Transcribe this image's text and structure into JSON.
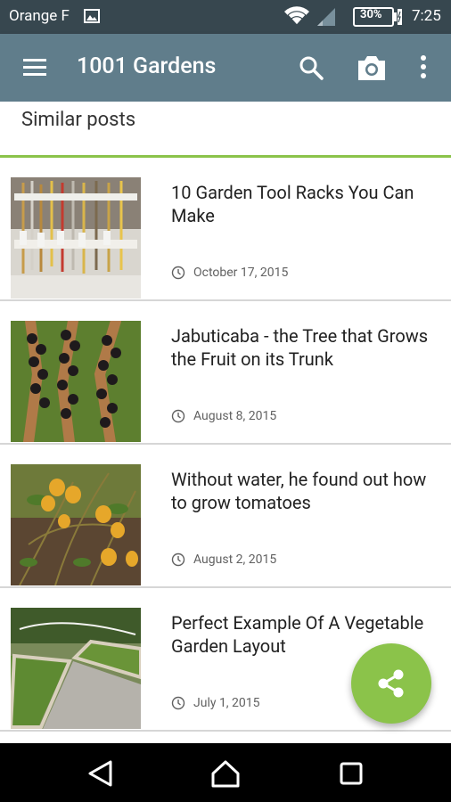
{
  "status_bar": {
    "carrier": "Orange F",
    "battery": "30%",
    "time": "7:25",
    "icons": [
      "image-notification-icon",
      "wifi-icon",
      "cell-signal-icon",
      "battery-charging-icon"
    ]
  },
  "app_bar": {
    "title": "1001 Gardens",
    "icons": [
      "menu-icon",
      "search-icon",
      "camera-icon",
      "more-vert-icon"
    ],
    "color": "#607d8b"
  },
  "section": {
    "label": "Similar posts",
    "accent_color": "#8bc34a"
  },
  "posts": [
    {
      "title": "10 Garden Tool Racks You Can Make",
      "date": "October 17, 2015"
    },
    {
      "title": "Jabuticaba - the Tree that Grows the Fruit on its Trunk",
      "date": "August 8, 2015"
    },
    {
      "title": "Without water, he found out how to grow tomatoes",
      "date": "August 2, 2015"
    },
    {
      "title": "Perfect Example Of A Vegetable Garden Layout",
      "date": "July 1, 2015"
    }
  ],
  "fab": {
    "icon": "share-icon",
    "color": "#8bc34a"
  },
  "nav_bar": {
    "icons": [
      "back-icon",
      "home-icon",
      "recents-icon"
    ]
  }
}
